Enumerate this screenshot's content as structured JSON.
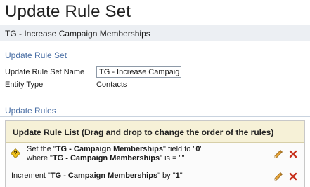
{
  "header": {
    "title": "Update Rule Set"
  },
  "subtitle": "TG - Increase Campaign Memberships",
  "section_general": {
    "heading": "Update Rule Set",
    "name_label": "Update Rule Set Name",
    "name_value": "TG - Increase Campaign Memberships",
    "entity_label": "Entity Type",
    "entity_value": "Contacts"
  },
  "section_rules": {
    "heading": "Update Rules",
    "list_header": "Update Rule List (Drag and drop to change the order of the rules)",
    "rules": [
      {
        "line1_pre": "Set the \"",
        "line1_field": "TG - Campaign Memberships",
        "line1_mid": "\" field to \"",
        "line1_value": "0",
        "line1_post": "\"",
        "line2_pre": "where \"",
        "line2_field": "TG - Campaign Memberships",
        "line2_post": "\" is = \"\"",
        "icon": "warning-diamond-icon"
      },
      {
        "pre": "Increment \"",
        "field": "TG - Campaign Memberships",
        "mid": "\" by \"",
        "value": "1",
        "post": "\""
      }
    ]
  },
  "colors": {
    "section_heading": "#4a6fa5",
    "list_header_bg": "#f6f1d7",
    "edit_pencil": "#d08a1e",
    "delete_x": "#c8321e"
  }
}
